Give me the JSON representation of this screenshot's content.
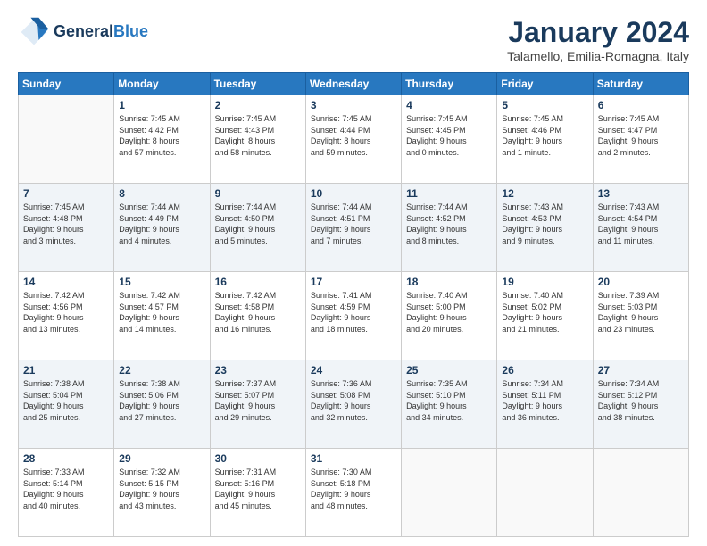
{
  "header": {
    "logo_line1": "General",
    "logo_line2": "Blue",
    "title": "January 2024",
    "subtitle": "Talamello, Emilia-Romagna, Italy"
  },
  "weekdays": [
    "Sunday",
    "Monday",
    "Tuesday",
    "Wednesday",
    "Thursday",
    "Friday",
    "Saturday"
  ],
  "weeks": [
    [
      {
        "day": "",
        "info": ""
      },
      {
        "day": "1",
        "info": "Sunrise: 7:45 AM\nSunset: 4:42 PM\nDaylight: 8 hours\nand 57 minutes."
      },
      {
        "day": "2",
        "info": "Sunrise: 7:45 AM\nSunset: 4:43 PM\nDaylight: 8 hours\nand 58 minutes."
      },
      {
        "day": "3",
        "info": "Sunrise: 7:45 AM\nSunset: 4:44 PM\nDaylight: 8 hours\nand 59 minutes."
      },
      {
        "day": "4",
        "info": "Sunrise: 7:45 AM\nSunset: 4:45 PM\nDaylight: 9 hours\nand 0 minutes."
      },
      {
        "day": "5",
        "info": "Sunrise: 7:45 AM\nSunset: 4:46 PM\nDaylight: 9 hours\nand 1 minute."
      },
      {
        "day": "6",
        "info": "Sunrise: 7:45 AM\nSunset: 4:47 PM\nDaylight: 9 hours\nand 2 minutes."
      }
    ],
    [
      {
        "day": "7",
        "info": "Sunrise: 7:45 AM\nSunset: 4:48 PM\nDaylight: 9 hours\nand 3 minutes."
      },
      {
        "day": "8",
        "info": "Sunrise: 7:44 AM\nSunset: 4:49 PM\nDaylight: 9 hours\nand 4 minutes."
      },
      {
        "day": "9",
        "info": "Sunrise: 7:44 AM\nSunset: 4:50 PM\nDaylight: 9 hours\nand 5 minutes."
      },
      {
        "day": "10",
        "info": "Sunrise: 7:44 AM\nSunset: 4:51 PM\nDaylight: 9 hours\nand 7 minutes."
      },
      {
        "day": "11",
        "info": "Sunrise: 7:44 AM\nSunset: 4:52 PM\nDaylight: 9 hours\nand 8 minutes."
      },
      {
        "day": "12",
        "info": "Sunrise: 7:43 AM\nSunset: 4:53 PM\nDaylight: 9 hours\nand 9 minutes."
      },
      {
        "day": "13",
        "info": "Sunrise: 7:43 AM\nSunset: 4:54 PM\nDaylight: 9 hours\nand 11 minutes."
      }
    ],
    [
      {
        "day": "14",
        "info": "Sunrise: 7:42 AM\nSunset: 4:56 PM\nDaylight: 9 hours\nand 13 minutes."
      },
      {
        "day": "15",
        "info": "Sunrise: 7:42 AM\nSunset: 4:57 PM\nDaylight: 9 hours\nand 14 minutes."
      },
      {
        "day": "16",
        "info": "Sunrise: 7:42 AM\nSunset: 4:58 PM\nDaylight: 9 hours\nand 16 minutes."
      },
      {
        "day": "17",
        "info": "Sunrise: 7:41 AM\nSunset: 4:59 PM\nDaylight: 9 hours\nand 18 minutes."
      },
      {
        "day": "18",
        "info": "Sunrise: 7:40 AM\nSunset: 5:00 PM\nDaylight: 9 hours\nand 20 minutes."
      },
      {
        "day": "19",
        "info": "Sunrise: 7:40 AM\nSunset: 5:02 PM\nDaylight: 9 hours\nand 21 minutes."
      },
      {
        "day": "20",
        "info": "Sunrise: 7:39 AM\nSunset: 5:03 PM\nDaylight: 9 hours\nand 23 minutes."
      }
    ],
    [
      {
        "day": "21",
        "info": "Sunrise: 7:38 AM\nSunset: 5:04 PM\nDaylight: 9 hours\nand 25 minutes."
      },
      {
        "day": "22",
        "info": "Sunrise: 7:38 AM\nSunset: 5:06 PM\nDaylight: 9 hours\nand 27 minutes."
      },
      {
        "day": "23",
        "info": "Sunrise: 7:37 AM\nSunset: 5:07 PM\nDaylight: 9 hours\nand 29 minutes."
      },
      {
        "day": "24",
        "info": "Sunrise: 7:36 AM\nSunset: 5:08 PM\nDaylight: 9 hours\nand 32 minutes."
      },
      {
        "day": "25",
        "info": "Sunrise: 7:35 AM\nSunset: 5:10 PM\nDaylight: 9 hours\nand 34 minutes."
      },
      {
        "day": "26",
        "info": "Sunrise: 7:34 AM\nSunset: 5:11 PM\nDaylight: 9 hours\nand 36 minutes."
      },
      {
        "day": "27",
        "info": "Sunrise: 7:34 AM\nSunset: 5:12 PM\nDaylight: 9 hours\nand 38 minutes."
      }
    ],
    [
      {
        "day": "28",
        "info": "Sunrise: 7:33 AM\nSunset: 5:14 PM\nDaylight: 9 hours\nand 40 minutes."
      },
      {
        "day": "29",
        "info": "Sunrise: 7:32 AM\nSunset: 5:15 PM\nDaylight: 9 hours\nand 43 minutes."
      },
      {
        "day": "30",
        "info": "Sunrise: 7:31 AM\nSunset: 5:16 PM\nDaylight: 9 hours\nand 45 minutes."
      },
      {
        "day": "31",
        "info": "Sunrise: 7:30 AM\nSunset: 5:18 PM\nDaylight: 9 hours\nand 48 minutes."
      },
      {
        "day": "",
        "info": ""
      },
      {
        "day": "",
        "info": ""
      },
      {
        "day": "",
        "info": ""
      }
    ]
  ]
}
